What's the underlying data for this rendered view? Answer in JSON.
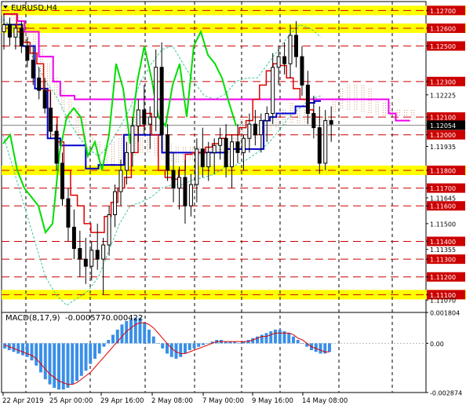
{
  "symbol_title": "EURUSD,H4",
  "macd_title": "MACD(8,17,9)",
  "macd_values": [
    "-0.000577",
    "-0.000422"
  ],
  "chart_data": [
    {
      "type": "candlestick",
      "symbol": "EURUSD",
      "timeframe": "H4",
      "ylim": [
        1.11,
        1.1275
      ],
      "price_scale_labels": [
        "1.12700",
        "1.12600",
        "1.12500",
        "1.12300",
        "1.12225",
        "1.12100",
        "1.12054",
        "1.12000",
        "1.11935",
        "1.11800",
        "1.11700",
        "1.11645",
        "1.11600",
        "1.11500",
        "1.11400",
        "1.11355",
        "1.11300",
        "1.11200",
        "1.11100",
        "1.11070"
      ],
      "highlighted_levels": [
        1.127,
        1.126,
        1.118,
        1.111
      ],
      "dashed_levels": [
        1.127,
        1.126,
        1.125,
        1.123,
        1.121,
        1.12,
        1.118,
        1.117,
        1.116,
        1.114,
        1.113,
        1.112,
        1.111
      ],
      "current_price": 1.12054,
      "x_labels": [
        "22 Apr 2019",
        "25 Apr 00:00",
        "29 Apr 16:00",
        "2 May 08:00",
        "7 May 00:00",
        "9 May 16:00",
        "14 May 08:00"
      ],
      "colors": {
        "highlight": "#ffff00",
        "level_line": "#cc0000",
        "current_price_box": "#000000",
        "kijun": "#0000cc",
        "tenkan": "#dd0000",
        "chikou": "#00dd00",
        "senkou_line": "#ee00ee",
        "cloud": "#c8906a",
        "envelope": "#40c8a0"
      },
      "kijun": [
        1.1262,
        1.1262,
        1.1262,
        1.125,
        1.125,
        1.1226,
        1.1226,
        1.1198,
        1.1198,
        1.1194,
        1.1194,
        1.1194,
        1.1194,
        1.1181,
        1.1181,
        1.1183,
        1.1183,
        1.1183,
        1.1183,
        1.12,
        1.12,
        1.12,
        1.12,
        1.12,
        1.12,
        1.119,
        1.119,
        1.119,
        1.119,
        1.119,
        1.119,
        1.119,
        1.119,
        1.119,
        1.119,
        1.1192,
        1.1192,
        1.1192,
        1.1192,
        1.1192,
        1.1192,
        1.1208,
        1.121,
        1.1212,
        1.1212,
        1.1212,
        1.1216,
        1.1216,
        1.1218,
        1.1219,
        1.1219
      ],
      "tenkan": [
        1.1268,
        1.1268,
        1.1258,
        1.1252,
        1.1246,
        1.124,
        1.1225,
        1.121,
        1.1196,
        1.118,
        1.1166,
        1.116,
        1.115,
        1.1145,
        1.1145,
        1.1154,
        1.1162,
        1.117,
        1.1176,
        1.119,
        1.1205,
        1.1212,
        1.12,
        1.118,
        1.1176,
        1.1175,
        1.118,
        1.1189,
        1.119,
        1.119,
        1.1193,
        1.1195,
        1.1198,
        1.12,
        1.12,
        1.1204,
        1.1208,
        1.122,
        1.1228,
        1.1236,
        1.124,
        1.1239,
        1.1232,
        1.1226,
        1.122,
        1.1214,
        1.121,
        1.121
      ],
      "chikou": [
        1.1195,
        1.12,
        1.118,
        1.117,
        1.1165,
        1.116,
        1.1145,
        1.115,
        1.119,
        1.121,
        1.1215,
        1.121,
        1.1188,
        1.1196,
        1.118,
        1.12,
        1.124,
        1.1226,
        1.1195,
        1.123,
        1.125,
        1.1232,
        1.121,
        1.1205,
        1.1228,
        1.124,
        1.121,
        1.125,
        1.1258,
        1.1245,
        1.124,
        1.1232,
        1.1218,
        1.1205
      ],
      "senkou_line": [
        1.1268,
        1.1268,
        1.1264,
        1.1258,
        1.1258,
        1.1244,
        1.1244,
        1.123,
        1.1222,
        1.1222,
        1.122,
        1.122,
        1.122,
        1.122,
        1.122,
        1.122,
        1.122,
        1.122,
        1.122,
        1.122,
        1.122,
        1.122,
        1.122,
        1.122,
        1.122,
        1.122,
        1.122,
        1.122,
        1.122,
        1.122,
        1.122,
        1.122,
        1.122,
        1.122,
        1.122,
        1.122,
        1.122,
        1.122,
        1.122,
        1.122,
        1.122,
        1.122,
        1.122,
        1.122,
        1.122,
        1.122,
        1.122,
        1.122,
        1.122,
        1.122,
        1.122,
        1.122,
        1.122,
        1.122,
        1.1212,
        1.1208,
        1.1208,
        1.1208
      ],
      "cloud_upper": [
        1.127,
        1.127,
        1.1266,
        1.1262,
        1.1258,
        1.1248,
        1.124,
        1.1232,
        1.1225,
        1.122,
        1.1215,
        1.121,
        1.12,
        1.1196,
        1.1194,
        1.1196,
        1.1198,
        1.1205,
        1.121,
        1.1205,
        1.12,
        1.1198,
        1.1196,
        1.1195,
        1.1193,
        1.1193,
        1.1193,
        1.1193,
        1.1193,
        1.1192,
        1.1192,
        1.1193,
        1.1198,
        1.121,
        1.1206,
        1.1205,
        1.1205,
        1.1208,
        1.121,
        1.1214,
        1.1218,
        1.1215,
        1.1214,
        1.1212,
        1.121,
        1.121,
        1.122,
        1.1226,
        1.1228,
        1.1228,
        1.1228,
        1.1226,
        1.122,
        1.1218,
        1.1218,
        1.1214,
        1.1214,
        1.1214
      ],
      "cloud_lower": [
        1.1268,
        1.1264,
        1.1258,
        1.125,
        1.1242,
        1.1232,
        1.1226,
        1.122,
        1.1214,
        1.1208,
        1.12,
        1.1196,
        1.119,
        1.1186,
        1.1184,
        1.1182,
        1.1183,
        1.1185,
        1.1188,
        1.119,
        1.119,
        1.1188,
        1.1186,
        1.1185,
        1.1184,
        1.1184,
        1.1186,
        1.1188,
        1.119,
        1.119,
        1.119,
        1.119,
        1.1192,
        1.1194,
        1.1196,
        1.1198,
        1.12,
        1.1202,
        1.1204,
        1.1205,
        1.1206,
        1.1206,
        1.1206,
        1.1206,
        1.1207,
        1.1208,
        1.1212,
        1.1214,
        1.1214,
        1.1214,
        1.1213,
        1.1212,
        1.1211,
        1.121,
        1.121,
        1.121,
        1.121,
        1.121
      ],
      "envelope_upper": [
        1.1265,
        1.126,
        1.125,
        1.1242,
        1.123,
        1.1222,
        1.121,
        1.12,
        1.1192,
        1.1188,
        1.1194,
        1.1204,
        1.1215,
        1.123,
        1.124,
        1.1248,
        1.125,
        1.124,
        1.123,
        1.1222,
        1.122,
        1.1223,
        1.123,
        1.1232,
        1.1232,
        1.124,
        1.1248,
        1.1256,
        1.1262,
        1.126,
        1.1255
      ],
      "envelope_lower": [
        1.12,
        1.118,
        1.116,
        1.114,
        1.112,
        1.111,
        1.1104,
        1.1108,
        1.1112,
        1.112,
        1.1135,
        1.115,
        1.116,
        1.1162,
        1.1165,
        1.117,
        1.1172,
        1.1172,
        1.1175,
        1.1176,
        1.1178,
        1.1182,
        1.1183,
        1.1186,
        1.119,
        1.1195,
        1.1202,
        1.121,
        1.1215,
        1.122,
        1.1222
      ],
      "candles": [
        [
          1.1258,
          1.1268,
          1.1248,
          1.1262
        ],
        [
          1.1262,
          1.1266,
          1.125,
          1.1255
        ],
        [
          1.1255,
          1.1262,
          1.1248,
          1.126
        ],
        [
          1.126,
          1.1264,
          1.1246,
          1.125
        ],
        [
          1.125,
          1.1255,
          1.1238,
          1.1242
        ],
        [
          1.1242,
          1.125,
          1.1228,
          1.1232
        ],
        [
          1.1232,
          1.1238,
          1.122,
          1.1225
        ],
        [
          1.1225,
          1.1232,
          1.1212,
          1.1215
        ],
        [
          1.1215,
          1.1224,
          1.1198,
          1.1202
        ],
        [
          1.1202,
          1.1206,
          1.118,
          1.1184
        ],
        [
          1.1184,
          1.119,
          1.116,
          1.1164
        ],
        [
          1.1164,
          1.117,
          1.114,
          1.1148
        ],
        [
          1.1148,
          1.1158,
          1.113,
          1.1136
        ],
        [
          1.1136,
          1.1146,
          1.112,
          1.113
        ],
        [
          1.113,
          1.1142,
          1.1116,
          1.1126
        ],
        [
          1.1126,
          1.114,
          1.1118,
          1.1135
        ],
        [
          1.1135,
          1.115,
          1.1124,
          1.113
        ],
        [
          1.113,
          1.1142,
          1.111,
          1.1138
        ],
        [
          1.1138,
          1.116,
          1.1132,
          1.1155
        ],
        [
          1.1155,
          1.1172,
          1.1148,
          1.1168
        ],
        [
          1.1168,
          1.1186,
          1.116,
          1.118
        ],
        [
          1.118,
          1.1196,
          1.1172,
          1.119
        ],
        [
          1.119,
          1.121,
          1.1182,
          1.1205
        ],
        [
          1.1205,
          1.122,
          1.1196,
          1.1214
        ],
        [
          1.1214,
          1.1228,
          1.12,
          1.1206
        ],
        [
          1.1206,
          1.1216,
          1.1192,
          1.121
        ],
        [
          1.121,
          1.1248,
          1.1202,
          1.1238
        ],
        [
          1.1238,
          1.1252,
          1.1192,
          1.12
        ],
        [
          1.12,
          1.1206,
          1.1174,
          1.118
        ],
        [
          1.118,
          1.119,
          1.1162,
          1.117
        ],
        [
          1.117,
          1.1182,
          1.1158,
          1.1176
        ],
        [
          1.1176,
          1.1186,
          1.115,
          1.116
        ],
        [
          1.116,
          1.1178,
          1.1154,
          1.1172
        ],
        [
          1.1172,
          1.1198,
          1.1162,
          1.1192
        ],
        [
          1.1192,
          1.1204,
          1.1176,
          1.1182
        ],
        [
          1.1182,
          1.1196,
          1.1174,
          1.119
        ],
        [
          1.119,
          1.1198,
          1.1178,
          1.1194
        ],
        [
          1.1194,
          1.1204,
          1.1186,
          1.1198
        ],
        [
          1.1198,
          1.1206,
          1.1176,
          1.1182
        ],
        [
          1.1182,
          1.12,
          1.117,
          1.1196
        ],
        [
          1.1196,
          1.1206,
          1.1184,
          1.119
        ],
        [
          1.119,
          1.12,
          1.118,
          1.1198
        ],
        [
          1.1198,
          1.1212,
          1.119,
          1.1206
        ],
        [
          1.1206,
          1.1214,
          1.1194,
          1.12
        ],
        [
          1.12,
          1.1212,
          1.119,
          1.1208
        ],
        [
          1.1208,
          1.1216,
          1.1196,
          1.1212
        ],
        [
          1.1212,
          1.1246,
          1.1206,
          1.1238
        ],
        [
          1.1238,
          1.125,
          1.1228,
          1.1244
        ],
        [
          1.1244,
          1.1252,
          1.1234,
          1.124
        ],
        [
          1.124,
          1.1262,
          1.1232,
          1.1256
        ],
        [
          1.1256,
          1.1264,
          1.1238,
          1.1244
        ],
        [
          1.1244,
          1.125,
          1.1222,
          1.1228
        ],
        [
          1.1228,
          1.1236,
          1.1206,
          1.1212
        ],
        [
          1.1212,
          1.1222,
          1.1198,
          1.1204
        ],
        [
          1.1204,
          1.1216,
          1.1178,
          1.1184
        ],
        [
          1.1184,
          1.1214,
          1.118,
          1.1208
        ],
        [
          1.1208,
          1.1216,
          1.1196,
          1.1206
        ]
      ]
    },
    {
      "type": "histogram",
      "title": "MACD(8,17,9)",
      "ylim": [
        -0.002874,
        0.001804
      ],
      "price_scale_labels": [
        "0.001804",
        "0.00",
        "-0.002874"
      ],
      "zero_level": 0.0,
      "colors": {
        "histogram": "#3a8fe8",
        "signal": "#dd0000"
      },
      "histogram": [
        -0.0003,
        -0.0004,
        -0.0005,
        -0.0006,
        -0.0007,
        -0.0008,
        -0.001,
        -0.0013,
        -0.0017,
        -0.0021,
        -0.0024,
        -0.0026,
        -0.0027,
        -0.0027,
        -0.0026,
        -0.0024,
        -0.0022,
        -0.0019,
        -0.0016,
        -0.0012,
        -0.0009,
        -0.0006,
        -0.0002,
        0.0002,
        0.0005,
        0.0008,
        0.0011,
        0.0013,
        0.0014,
        0.0015,
        0.0015,
        0.0012,
        0.0008,
        0.0004,
        0.0,
        -0.0003,
        -0.0006,
        -0.0008,
        -0.0009,
        -0.0008,
        -0.0006,
        -0.0004,
        -0.0003,
        -0.0002,
        -0.0001,
        0.0,
        0.0001,
        0.0002,
        0.0002,
        0.0001,
        0.0001,
        0.0001,
        0.0,
        0.0001,
        0.0002,
        0.0003,
        0.0004,
        0.0005,
        0.0006,
        0.0007,
        0.0008,
        0.0008,
        0.0007,
        0.0006,
        0.0004,
        0.0002,
        0.0,
        -0.0002,
        -0.0004,
        -0.0005,
        -0.0006,
        -0.0006,
        -0.0005
      ],
      "signal": [
        -0.0001,
        -0.0002,
        -0.0003,
        -0.0004,
        -0.0005,
        -0.0006,
        -0.0007,
        -0.0009,
        -0.0012,
        -0.0015,
        -0.0018,
        -0.002,
        -0.0022,
        -0.0023,
        -0.0024,
        -0.0024,
        -0.0023,
        -0.0021,
        -0.0019,
        -0.0017,
        -0.0014,
        -0.0011,
        -0.0008,
        -0.0005,
        -0.0002,
        0.0001,
        0.0004,
        0.0007,
        0.0009,
        0.0011,
        0.0012,
        0.0012,
        0.0011,
        0.0009,
        0.0006,
        0.0003,
        0.0,
        -0.0003,
        -0.0005,
        -0.0006,
        -0.0006,
        -0.0005,
        -0.0004,
        -0.0003,
        -0.0002,
        -0.0001,
        0.0,
        0.0001,
        0.0001,
        0.0001,
        0.0001,
        0.0001,
        0.0001,
        0.0001,
        0.0001,
        0.0002,
        0.0003,
        0.0004,
        0.0004,
        0.0005,
        0.0006,
        0.0006,
        0.0006,
        0.0006,
        0.0005,
        0.0003,
        0.0002,
        0.0,
        -0.0002,
        -0.0003,
        -0.0004,
        -0.0005,
        -0.0005
      ]
    }
  ]
}
